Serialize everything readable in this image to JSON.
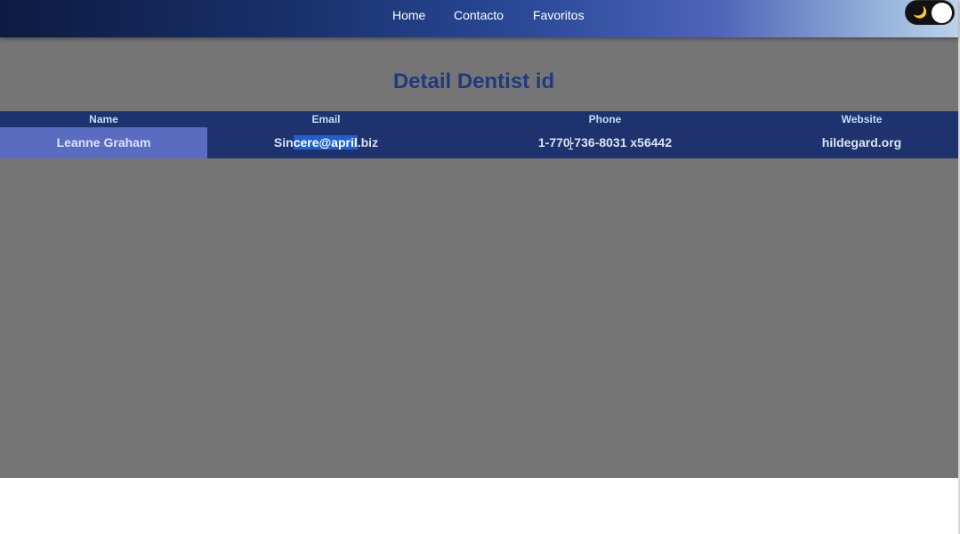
{
  "nav": {
    "links": [
      "Home",
      "Contacto",
      "Favoritos"
    ],
    "theme_toggle_icon": "moon-icon",
    "theme_toggle_glyph": "🌙",
    "theme_mode": "dark"
  },
  "page": {
    "title": "Detail Dentist id"
  },
  "table": {
    "headers": [
      "Name",
      "Email",
      "Phone",
      "Website"
    ],
    "rows": [
      {
        "name": "Leanne Graham",
        "email_before": "Sin",
        "email_selected": "cere@april",
        "email_after": ".biz",
        "phone": "1-770-736-8031 x56442",
        "website": "hildegard.org"
      }
    ]
  },
  "colors": {
    "title": "#1f3b7e",
    "table_header_bg": "#1c3370",
    "row_bg": "#1e326d",
    "name_cell_bg": "#5a6cc0",
    "content_bg": "#757575",
    "selection": "#1f5fd1"
  }
}
